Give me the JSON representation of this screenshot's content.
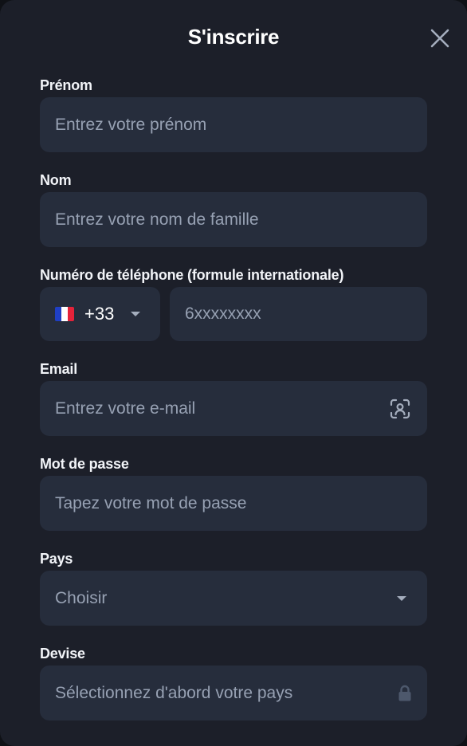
{
  "header": {
    "title": "S'inscrire"
  },
  "icons": {
    "close": "close-icon",
    "chevron": "chevron-down-icon",
    "email_scan": "face-scan-icon",
    "lock": "lock-icon"
  },
  "colors": {
    "background": "#1c1f29",
    "field": "#262d3c",
    "text": "#ffffff",
    "placeholder": "#97a1b3"
  },
  "form": {
    "first_name": {
      "label": "Prénom",
      "placeholder": "Entrez votre prénom"
    },
    "last_name": {
      "label": "Nom",
      "placeholder": "Entrez votre nom de famille"
    },
    "phone": {
      "label": "Numéro de téléphone (formule internationale)",
      "country_code": "+33",
      "placeholder": "6xxxxxxxx"
    },
    "email": {
      "label": "Email",
      "placeholder": "Entrez votre e-mail"
    },
    "password": {
      "label": "Mot de passe",
      "placeholder": "Tapez votre mot de passe"
    },
    "country": {
      "label": "Pays",
      "selected": "Choisir"
    },
    "currency": {
      "label": "Devise",
      "placeholder": "Sélectionnez d'abord votre pays"
    }
  }
}
